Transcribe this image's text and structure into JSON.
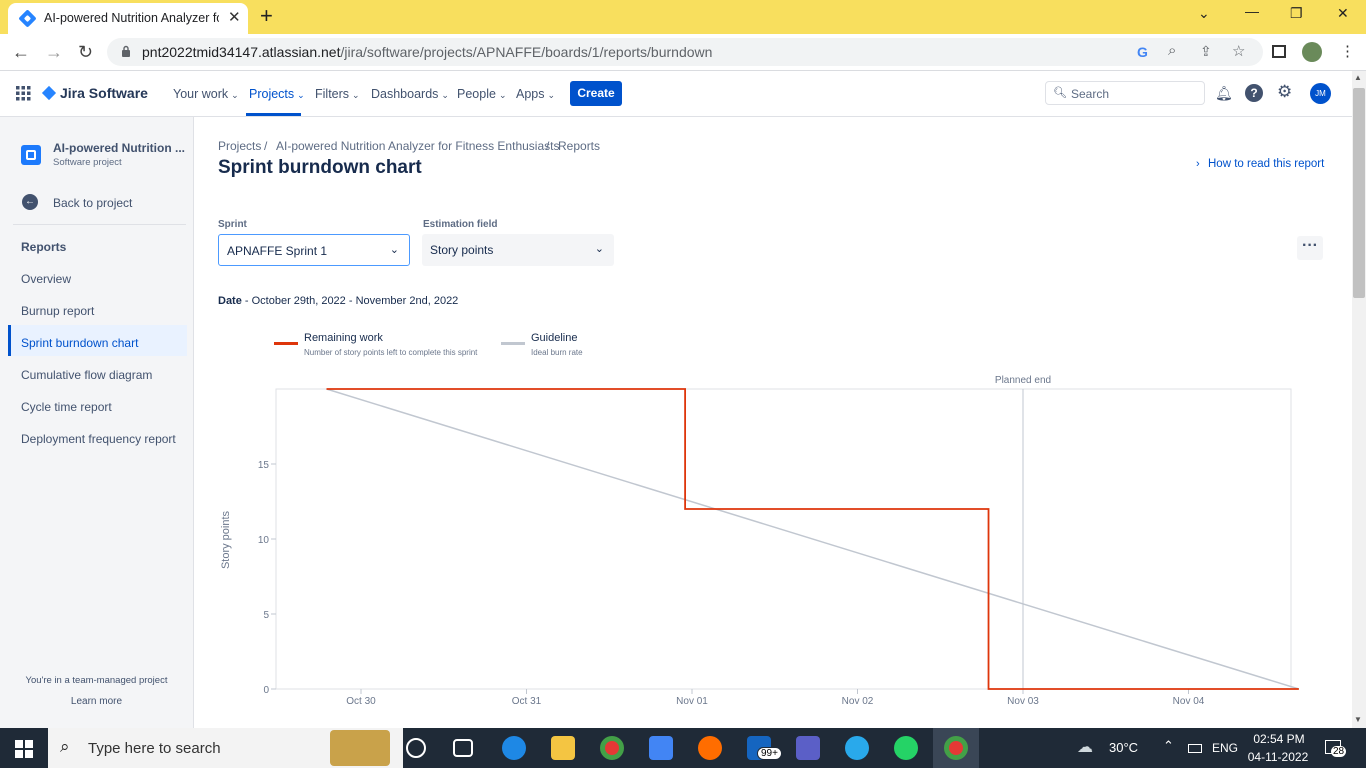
{
  "browser": {
    "tab_title": "AI-powered Nutrition Analyzer fo",
    "url_host": "pnt2022tmid34147.atlassian.net",
    "url_path": "/jira/software/projects/APNAFFE/boards/1/reports/burndown"
  },
  "jira": {
    "product": "Jira Software",
    "nav": [
      "Your work",
      "Projects",
      "Filters",
      "Dashboards",
      "People",
      "Apps"
    ],
    "create_label": "Create",
    "search_placeholder": "Search",
    "avatar": "JM"
  },
  "sidebar": {
    "project_name": "AI-powered Nutrition ...",
    "project_type": "Software project",
    "back": "Back to project",
    "section": "Reports",
    "items": [
      "Overview",
      "Burnup report",
      "Sprint burndown chart",
      "Cumulative flow diagram",
      "Cycle time report",
      "Deployment frequency report"
    ],
    "footer": "You're in a team-managed project",
    "learn_more": "Learn more"
  },
  "main": {
    "breadcrumbs": [
      "Projects",
      "AI-powered Nutrition Analyzer for Fitness Enthusiasts",
      "Reports"
    ],
    "title": "Sprint burndown chart",
    "how_to_read": "How to read this report",
    "sprint_label": "Sprint",
    "sprint_value": "APNAFFE Sprint 1",
    "estimation_label": "Estimation field",
    "estimation_value": "Story points",
    "date_label": "Date",
    "date_range": " - October 29th, 2022 - November 2nd, 2022"
  },
  "chart_data": {
    "type": "line",
    "ylabel": "Story points",
    "yticks": [
      0,
      5,
      10,
      15
    ],
    "ylim": [
      0,
      20
    ],
    "xticks": [
      "Oct 30",
      "Oct 31",
      "Nov 01",
      "Nov 02",
      "Nov 03",
      "Nov 04"
    ],
    "planned_end_label": "Planned end",
    "legend": [
      {
        "name": "Remaining work",
        "desc": "Number of story points left to complete this sprint",
        "color": "#DE350B"
      },
      {
        "name": "Guideline",
        "desc": "Ideal burn rate",
        "color": "#C1C7D0"
      }
    ],
    "remaining_work": [
      {
        "x": "Oct 29 19:00",
        "y": 20
      },
      {
        "x": "Oct 31 23:00",
        "y": 20
      },
      {
        "x": "Oct 31 23:00",
        "y": 12
      },
      {
        "x": "Nov 02 19:00",
        "y": 12
      },
      {
        "x": "Nov 02 19:00",
        "y": 0
      },
      {
        "x": "Nov 04 16:00",
        "y": 0
      }
    ],
    "guideline": [
      {
        "x": "Oct 29 19:00",
        "y": 20
      },
      {
        "x": "Nov 04 16:00",
        "y": 0
      }
    ],
    "planned_end": "Nov 02 24:00"
  },
  "taskbar": {
    "search_placeholder": "Type here to search",
    "weather": "30°C",
    "lang": "ENG",
    "time": "02:54 PM",
    "date": "04-11-2022",
    "mail_badge": "99+",
    "notif_badge": "28"
  }
}
